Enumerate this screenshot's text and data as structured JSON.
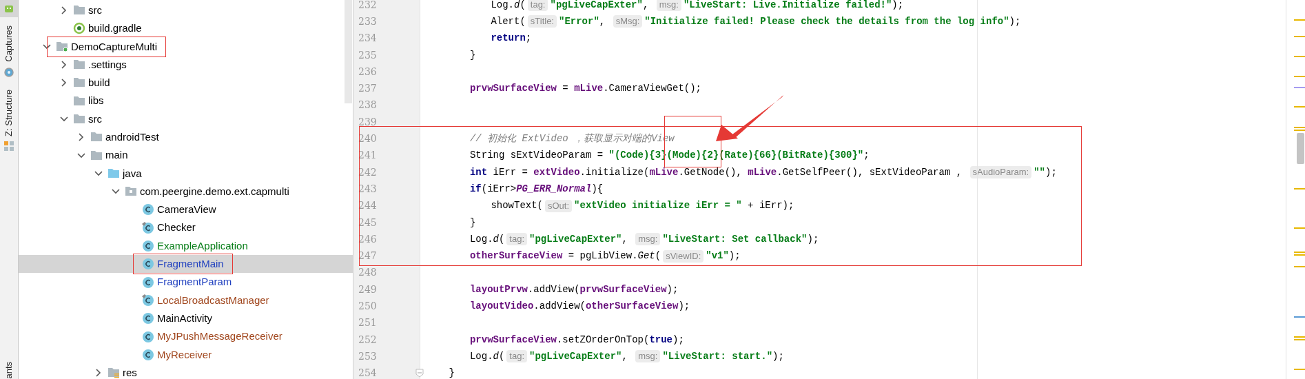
{
  "side_tabs": [
    {
      "label": "Captures"
    },
    {
      "label": "Z: Structure"
    },
    {
      "label": "ants"
    }
  ],
  "tree": [
    {
      "children": [
        {
          "label": "src",
          "kind": "folder",
          "expanded": false,
          "selected": false,
          "color": "#000000"
        },
        {
          "label": "build.gradle",
          "kind": "gradle",
          "selected": false,
          "color": "#000000"
        }
      ]
    },
    {
      "label": "DemoCaptureMulti",
      "kind": "module",
      "expanded": true,
      "selected": false,
      "annotated": true,
      "color": "#000000",
      "children": [
        {
          "label": ".settings",
          "kind": "folder",
          "expanded": false,
          "selected": false,
          "color": "#000000"
        },
        {
          "label": "build",
          "kind": "folder",
          "expanded": false,
          "selected": false,
          "color": "#000000"
        },
        {
          "label": "libs",
          "kind": "folder",
          "selected": false,
          "color": "#000000"
        },
        {
          "label": "src",
          "kind": "folder",
          "expanded": true,
          "selected": false,
          "color": "#000000",
          "children": [
            {
              "label": "androidTest",
              "kind": "folder",
              "expanded": false,
              "selected": false,
              "color": "#000000"
            },
            {
              "label": "main",
              "kind": "folder",
              "expanded": true,
              "selected": false,
              "color": "#000000",
              "children": [
                {
                  "label": "java",
                  "kind": "source",
                  "expanded": true,
                  "selected": false,
                  "color": "#000000",
                  "children": [
                    {
                      "label": "com.peergine.demo.ext.capmulti",
                      "kind": "package",
                      "expanded": true,
                      "selected": false,
                      "color": "#000000",
                      "children": [
                        {
                          "label": "CameraView",
                          "kind": "class",
                          "selected": false,
                          "color": "#000000"
                        },
                        {
                          "label": "Checker",
                          "kind": "class",
                          "pinned": true,
                          "selected": false,
                          "color": "#000000"
                        },
                        {
                          "label": "ExampleApplication",
                          "kind": "class",
                          "selected": false,
                          "color": "#067d17"
                        },
                        {
                          "label": "FragmentMain",
                          "kind": "class",
                          "selected": true,
                          "annotated": true,
                          "color": "#1f3fbf"
                        },
                        {
                          "label": "FragmentParam",
                          "kind": "class",
                          "selected": false,
                          "color": "#1f3fbf"
                        },
                        {
                          "label": "LocalBroadcastManager",
                          "kind": "class",
                          "pinned": true,
                          "selected": false,
                          "color": "#a0461d"
                        },
                        {
                          "label": "MainActivity",
                          "kind": "class",
                          "selected": false,
                          "color": "#000000"
                        },
                        {
                          "label": "MyJPushMessageReceiver",
                          "kind": "class",
                          "selected": false,
                          "color": "#a0461d"
                        },
                        {
                          "label": "MyReceiver",
                          "kind": "class",
                          "selected": false,
                          "color": "#a0461d"
                        }
                      ]
                    }
                  ]
                },
                {
                  "label": "res",
                  "kind": "res",
                  "expanded": false,
                  "selected": false,
                  "color": "#000000"
                }
              ]
            }
          ]
        }
      ]
    }
  ],
  "code_blocks": [
    {
      "lines": [
        {
          "number": "232",
          "tokens": [
            {
              "kind": "plain",
              "text": "            Log."
            },
            {
              "kind": "italic",
              "text": "d"
            },
            {
              "kind": "plain",
              "text": "("
            },
            {
              "kind": "hint",
              "text": "tag:"
            },
            {
              "kind": "string",
              "text": "\"pgLiveCapExter\""
            },
            {
              "kind": "plain",
              "text": ", "
            },
            {
              "kind": "hint",
              "text": "msg:"
            },
            {
              "kind": "string",
              "text": "\"LiveStart: Live.Initialize failed!\""
            },
            {
              "kind": "plain",
              "text": ");"
            }
          ]
        },
        {
          "number": "233",
          "tokens": [
            {
              "kind": "plain",
              "text": "            Alert("
            },
            {
              "kind": "hint",
              "text": "sTitle:"
            },
            {
              "kind": "string",
              "text": "\"Error\""
            },
            {
              "kind": "plain",
              "text": ", "
            },
            {
              "kind": "hint",
              "text": "sMsg:"
            },
            {
              "kind": "string",
              "text": "\"Initialize failed! Please check the details from the log info\""
            },
            {
              "kind": "plain",
              "text": ");"
            }
          ]
        },
        {
          "number": "234",
          "tokens": [
            {
              "kind": "keyword",
              "text": "            return"
            },
            {
              "kind": "plain",
              "text": ";"
            }
          ]
        },
        {
          "number": "235",
          "tokens": [
            {
              "kind": "plain",
              "text": "        }"
            }
          ]
        },
        {
          "number": "236"
        },
        {
          "number": "237",
          "tokens": [
            {
              "kind": "field",
              "text": "        prvwSurfaceView"
            },
            {
              "kind": "plain",
              "text": " = "
            },
            {
              "kind": "field",
              "text": "mLive"
            },
            {
              "kind": "plain",
              "text": ".CameraViewGet();"
            }
          ]
        },
        {
          "number": "238"
        },
        {
          "number": "239"
        }
      ]
    },
    {
      "boxed": true,
      "lines": [
        {
          "number": "240",
          "tokens": [
            {
              "kind": "comment",
              "text": "        // 初始化 ExtVideo ，获取显示对端的View"
            }
          ]
        },
        {
          "number": "241",
          "tokens": [
            {
              "kind": "plain",
              "text": "        String sExtVideoParam = "
            },
            {
              "kind": "string",
              "text": "\"(Code){3}"
            },
            {
              "kind": "string",
              "text": "(Mode){2}",
              "boxed": true
            },
            {
              "kind": "string",
              "text": "(Rate){66}(BitRate){300}\""
            },
            {
              "kind": "plain",
              "text": ";"
            }
          ]
        },
        {
          "number": "242",
          "tokens": [
            {
              "kind": "keyword",
              "text": "        int"
            },
            {
              "kind": "plain",
              "text": " iErr = "
            },
            {
              "kind": "field",
              "text": "extVideo"
            },
            {
              "kind": "plain",
              "text": ".initialize("
            },
            {
              "kind": "field",
              "text": "mLive"
            },
            {
              "kind": "plain",
              "text": ".GetNode(), "
            },
            {
              "kind": "field",
              "text": "mLive"
            },
            {
              "kind": "plain",
              "text": ".GetSelfPeer(), sExtVideoParam , "
            },
            {
              "kind": "hint",
              "text": "sAudioParam:"
            },
            {
              "kind": "string",
              "text": "\"\""
            },
            {
              "kind": "plain",
              "text": ");"
            }
          ]
        },
        {
          "number": "243",
          "tokens": [
            {
              "kind": "keyword",
              "text": "        if"
            },
            {
              "kind": "plain",
              "text": "(iErr>"
            },
            {
              "kind": "constant",
              "text": "PG_ERR_Normal"
            },
            {
              "kind": "plain",
              "text": "){"
            }
          ]
        },
        {
          "number": "244",
          "tokens": [
            {
              "kind": "plain",
              "text": "            showText("
            },
            {
              "kind": "hint",
              "text": "sOut:"
            },
            {
              "kind": "string",
              "text": "\"extVideo initialize iErr = \""
            },
            {
              "kind": "plain",
              "text": " + iErr);"
            }
          ]
        },
        {
          "number": "245",
          "tokens": [
            {
              "kind": "plain",
              "text": "        }"
            }
          ]
        },
        {
          "number": "246",
          "tokens": [
            {
              "kind": "plain",
              "text": "        Log."
            },
            {
              "kind": "italic",
              "text": "d"
            },
            {
              "kind": "plain",
              "text": "("
            },
            {
              "kind": "hint",
              "text": "tag:"
            },
            {
              "kind": "string",
              "text": "\"pgLiveCapExter\""
            },
            {
              "kind": "plain",
              "text": ", "
            },
            {
              "kind": "hint",
              "text": "msg:"
            },
            {
              "kind": "string",
              "text": "\"LiveStart: Set callback\""
            },
            {
              "kind": "plain",
              "text": ");"
            }
          ]
        },
        {
          "number": "247",
          "tokens": [
            {
              "kind": "field",
              "text": "        otherSurfaceView"
            },
            {
              "kind": "plain",
              "text": " = pgLibView."
            },
            {
              "kind": "italic",
              "text": "Get"
            },
            {
              "kind": "plain",
              "text": "("
            },
            {
              "kind": "hint",
              "text": "sViewID:"
            },
            {
              "kind": "string",
              "text": "\"v1\""
            },
            {
              "kind": "plain",
              "text": ");"
            }
          ]
        }
      ]
    },
    {
      "lines": [
        {
          "number": "248"
        },
        {
          "number": "249",
          "tokens": [
            {
              "kind": "field",
              "text": "        layoutPrvw"
            },
            {
              "kind": "plain",
              "text": ".addView("
            },
            {
              "kind": "field",
              "text": "prvwSurfaceView"
            },
            {
              "kind": "plain",
              "text": ");"
            }
          ]
        },
        {
          "number": "250",
          "tokens": [
            {
              "kind": "field",
              "text": "        layoutVideo"
            },
            {
              "kind": "plain",
              "text": ".addView("
            },
            {
              "kind": "field",
              "text": "otherSurfaceView"
            },
            {
              "kind": "plain",
              "text": ");"
            }
          ]
        },
        {
          "number": "251"
        },
        {
          "number": "252",
          "tokens": [
            {
              "kind": "field",
              "text": "        prvwSurfaceView"
            },
            {
              "kind": "plain",
              "text": ".setZOrderOnTop("
            },
            {
              "kind": "keyword",
              "text": "true"
            },
            {
              "kind": "plain",
              "text": ");"
            }
          ]
        },
        {
          "number": "253",
          "tokens": [
            {
              "kind": "plain",
              "text": "        Log."
            },
            {
              "kind": "italic",
              "text": "d"
            },
            {
              "kind": "plain",
              "text": "("
            },
            {
              "kind": "hint",
              "text": "tag:"
            },
            {
              "kind": "string",
              "text": "\"pgLiveCapExter\""
            },
            {
              "kind": "plain",
              "text": ", "
            },
            {
              "kind": "hint",
              "text": "msg:"
            },
            {
              "kind": "string",
              "text": "\"LiveStart: start.\""
            },
            {
              "kind": "plain",
              "text": ");"
            }
          ]
        },
        {
          "number": "254",
          "fold": true,
          "tokens": [
            {
              "kind": "plain",
              "text": "    }"
            }
          ]
        }
      ]
    }
  ]
}
